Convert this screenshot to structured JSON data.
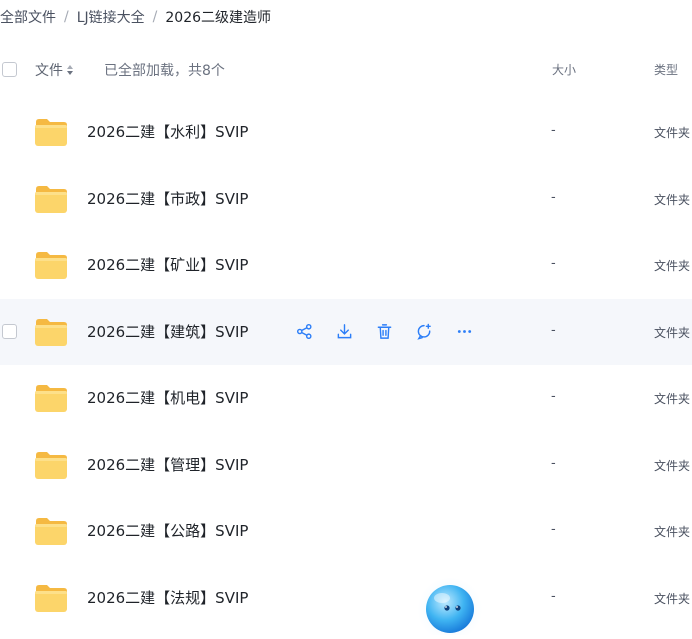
{
  "breadcrumb": {
    "items": [
      "全部文件",
      "LJ链接大全"
    ],
    "separator": "/",
    "current": "2026二级建造师"
  },
  "header": {
    "name_label": "文件",
    "loaded_text": "已全部加载，共8个",
    "size_label": "大小",
    "type_label": "类型"
  },
  "files": [
    {
      "name": "2026二建【水利】SVIP",
      "size": "-",
      "type": "文件夹"
    },
    {
      "name": "2026二建【市政】SVIP",
      "size": "-",
      "type": "文件夹"
    },
    {
      "name": "2026二建【矿业】SVIP",
      "size": "-",
      "type": "文件夹"
    },
    {
      "name": "2026二建【建筑】SVIP",
      "size": "-",
      "type": "文件夹"
    },
    {
      "name": "2026二建【机电】SVIP",
      "size": "-",
      "type": "文件夹"
    },
    {
      "name": "2026二建【管理】SVIP",
      "size": "-",
      "type": "文件夹"
    },
    {
      "name": "2026二建【公路】SVIP",
      "size": "-",
      "type": "文件夹"
    },
    {
      "name": "2026二建【法规】SVIP",
      "size": "-",
      "type": "文件夹"
    }
  ],
  "hovered_row_index": 3,
  "row_actions": [
    "share-icon",
    "download-icon",
    "delete-icon",
    "comment-icon",
    "more-icon"
  ],
  "colors": {
    "accent": "#2c7ef8",
    "folder": "#fcd56a",
    "hover_bg": "#f5f7fb"
  }
}
